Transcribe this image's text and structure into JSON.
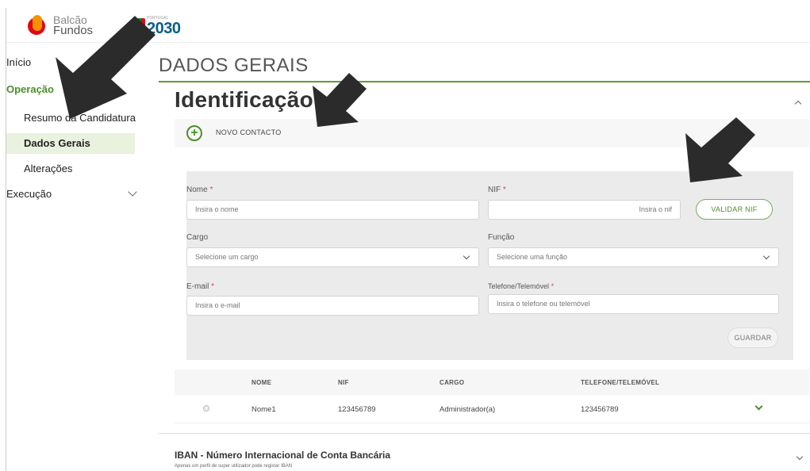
{
  "header": {
    "logo_balcao_line1": "Balcão",
    "logo_balcao_line2": "Fundos",
    "logo_pt_small": "PORTUGAL",
    "logo_pt_year": "2030"
  },
  "sidebar": {
    "items": [
      {
        "label": "Início"
      },
      {
        "label": "Operação"
      },
      {
        "label": "Resumo da Candidatura"
      },
      {
        "label": "Dados Gerais"
      },
      {
        "label": "Alterações"
      },
      {
        "label": "Execução"
      }
    ]
  },
  "main": {
    "page_title": "DADOS GERAIS",
    "section_title": "Identificação",
    "new_contact_label": "NOVO CONTACTO",
    "form": {
      "nome_label": "Nome",
      "nome_placeholder": "Insira o nome",
      "nif_label": "NIF",
      "nif_placeholder": "Insira o nif",
      "validar_label": "VALIDAR NIF",
      "cargo_label": "Cargo",
      "cargo_value": "Selecione um cargo",
      "funcao_label": "Função",
      "funcao_value": "Selecione uma função",
      "email_label": "E-mail",
      "email_placeholder": "Insira o e-mail",
      "telefone_label": "Telefone/Telemóvel",
      "telefone_placeholder": "Insira o telefone ou telemóvel",
      "guardar_label": "GUARDAR",
      "required_mark": "*"
    },
    "table": {
      "columns": [
        "NOME",
        "NIF",
        "CARGO",
        "TELEFONE/TELEMÓVEL"
      ],
      "rows": [
        {
          "nome": "Nome1",
          "nif": "123456789",
          "cargo": "Administrador(a)",
          "telefone": "123456789"
        }
      ]
    },
    "iban": {
      "title": "IBAN - Número Internacional de Conta Bancária",
      "subtitle": "Apenas um perfil de super utilizador pode registar IBAN"
    }
  },
  "colors": {
    "accent_green": "#4b8f29",
    "active_bg": "#e9f1df",
    "required_red": "#e04040"
  }
}
